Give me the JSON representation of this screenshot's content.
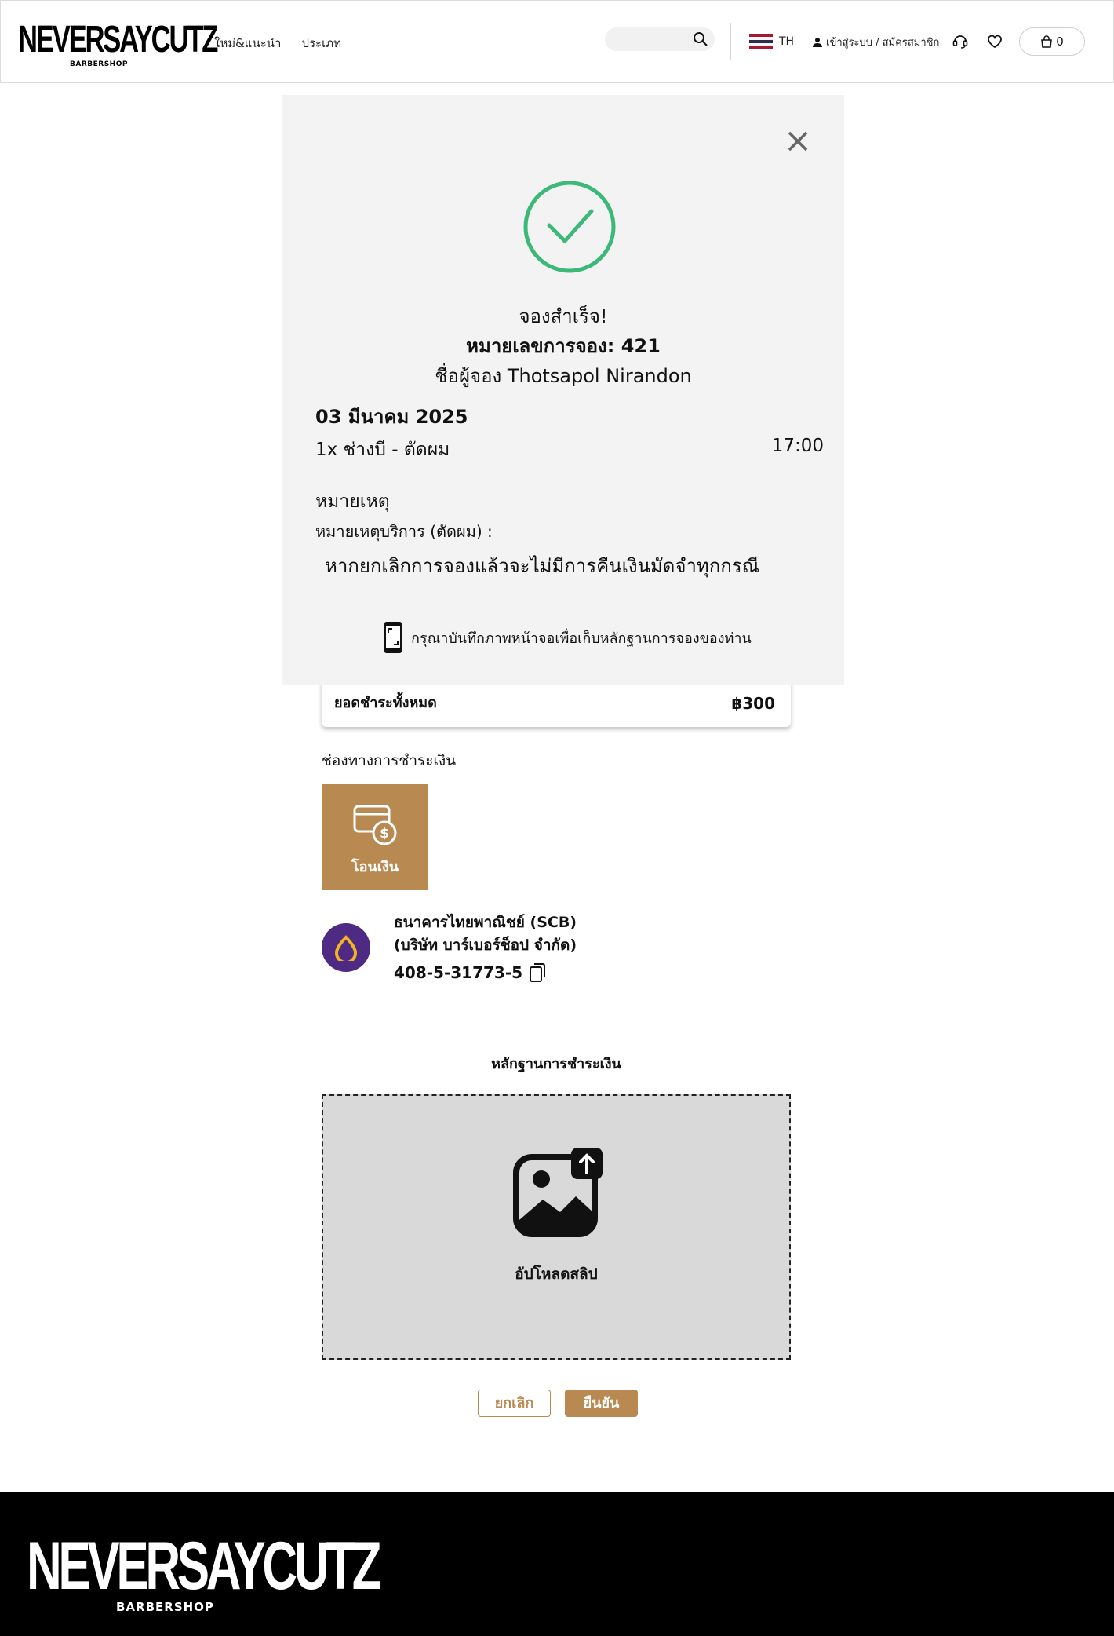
{
  "header": {
    "logo": "NEVERSAYCUTZ",
    "logo_sub": "BARBERSHOP",
    "nav": [
      "ใหม่&แนะนำ",
      "ประเภท"
    ],
    "search_placeholder": "",
    "lang": "TH",
    "login": "เข้าสู่ระบบ / สมัครสมาชิก",
    "cart_count": "0",
    "icons": [
      "search-icon",
      "user-icon",
      "support-icon",
      "heart-icon",
      "bag-icon"
    ]
  },
  "modal": {
    "title": "จองสำเร็จ!",
    "booking_number": "หมายเลขการจอง: 421",
    "booker": "ชื่อผู้จอง Thotsapol Nirandon",
    "date": "03 มีนาคม 2025",
    "service": "1x ช่างบี - ตัดผม",
    "time": "17:00",
    "note_heading": "หมายเหตุ",
    "note_label": "หมายเหตุบริการ (ตัดผม) :",
    "note_text": "หากยกเลิกการจองแล้วจะไม่มีการคืนเงินมัดจำทุกกรณี",
    "screenshot_hint": "กรุณาบันทึกภาพหน้าจอเพื่อเก็บหลักฐานการจองของท่าน"
  },
  "payment": {
    "total_label": "ยอดชำระทั้งหมด",
    "total_value": "฿300",
    "channel_heading": "ช่องทางการชำระเงิน",
    "transfer_label": "โอนเงิน",
    "bank_name": "ธนาคารไทยพาณิชย์ (SCB)",
    "account_name": "(บริษัท บาร์เบอร์ช็อป จำกัด)",
    "account_number": "408-5-31773-5",
    "proof_heading": "หลักฐานการชำระเงิน",
    "upload_label": "อัปโหลดสลิป",
    "cancel_label": "ยกเลิก",
    "confirm_label": "ยืนยัน"
  },
  "footer": {
    "logo": "NEVERSAYCUTZ",
    "logo_sub": "BARBERSHOP"
  },
  "colors": {
    "accent": "#b88a52",
    "success": "#3cb878",
    "scb": "#4e2a84",
    "modal_bg": "#f3f3f3"
  }
}
